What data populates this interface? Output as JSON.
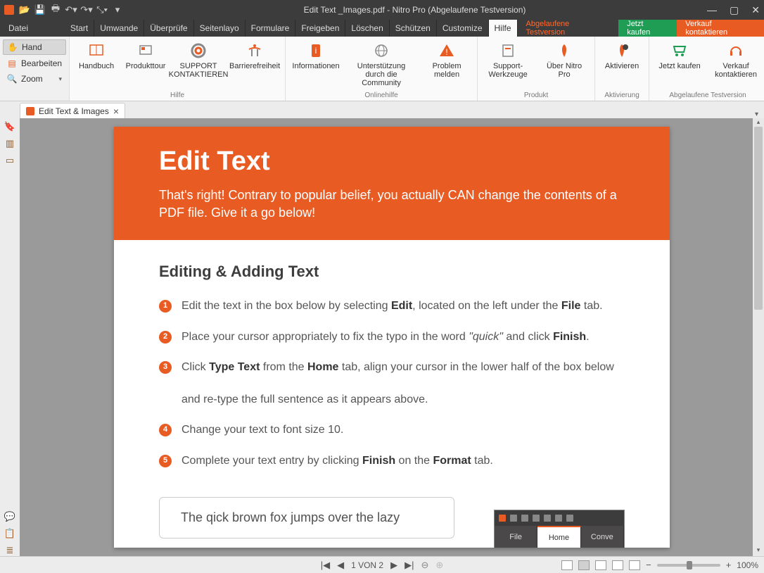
{
  "titlebar": {
    "title": "Edit Text _Images.pdf - Nitro Pro (Abgelaufene Testversion)"
  },
  "menubar": {
    "file": "Datei",
    "tabs": [
      "Start",
      "Umwande",
      "Überprüfe",
      "Seitenlayo",
      "Formulare",
      "Freigeben",
      "Löschen",
      "Schützen",
      "Customize",
      "Hilfe"
    ],
    "activeTab": "Hilfe",
    "expired": "Abgelaufene Testversion",
    "buy": "Jetzt kaufen",
    "contact": "Verkauf kontaktieren"
  },
  "leftpanel": {
    "hand": "Hand",
    "edit": "Bearbeiten",
    "zoom": "Zoom"
  },
  "ribbon": {
    "groups": [
      {
        "label": "Hilfe",
        "buttons": [
          {
            "label": "Handbuch",
            "icon": "book"
          },
          {
            "label": "Produkttour",
            "icon": "tour"
          },
          {
            "label": "SUPPORT KONTAKTIEREN",
            "icon": "life"
          },
          {
            "label": "Barrierefreiheit",
            "icon": "access"
          }
        ]
      },
      {
        "label": "Onlinehilfe",
        "buttons": [
          {
            "label": "Informationen",
            "icon": "info"
          },
          {
            "label": "Unterstützung durch die Community",
            "icon": "globe"
          },
          {
            "label": "Problem melden",
            "icon": "warn"
          }
        ]
      },
      {
        "label": "Produkt",
        "buttons": [
          {
            "label": "Support-Werkzeuge",
            "icon": "tool"
          },
          {
            "label": "Über Nitro Pro",
            "icon": "about"
          }
        ]
      },
      {
        "label": "Aktivierung",
        "buttons": [
          {
            "label": "Aktivieren",
            "icon": "key"
          }
        ]
      },
      {
        "label": "Abgelaufene Testversion",
        "buttons": [
          {
            "label": "Jetzt kaufen",
            "icon": "cart"
          },
          {
            "label": "Verkauf kontaktieren",
            "icon": "headset"
          }
        ]
      }
    ]
  },
  "doctab": {
    "title": "Edit Text & Images"
  },
  "page": {
    "heroTitle": "Edit Text",
    "heroBody": "That's right! Contrary to popular belief, you actually CAN change the contents of a PDF file. Give it a go below!",
    "sectionTitle": "Editing & Adding Text",
    "s1a": "Edit the text in the box below by selecting ",
    "s1b": "Edit",
    "s1c": ", located on the left under the ",
    "s1d": "File",
    "s1e": " tab.",
    "s2a": "Place your cursor appropriately to fix the typo in the word ",
    "s2b": "\"quick\"",
    "s2c": " and click ",
    "s2d": "Finish",
    "s2e": ".",
    "s3a": "Click ",
    "s3b": "Type Text",
    "s3c": " from the ",
    "s3d": "Home",
    "s3e": " tab, align your cursor in the lower half of the box below",
    "s3f": "and re-type the full sentence as it appears above.",
    "s4": "Change your text to font size 10.",
    "s5a": "Complete your text entry by clicking ",
    "s5b": "Finish",
    "s5c": " on the ",
    "s5d": "Format",
    "s5e": " tab.",
    "example": "The qick brown fox jumps over the lazy",
    "mini": {
      "file": "File",
      "home": "Home",
      "conv": "Conve"
    }
  },
  "status": {
    "page": "1 VON 2",
    "zoom": "100%"
  }
}
